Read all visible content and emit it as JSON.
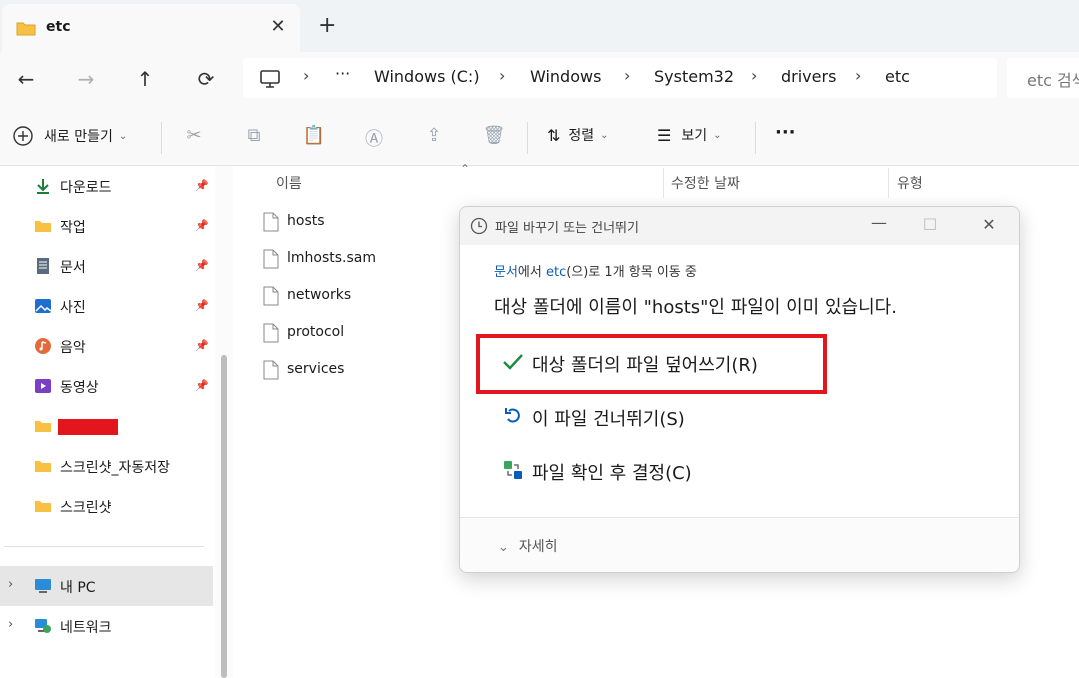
{
  "tab": {
    "title": "etc",
    "close": "✕",
    "new_tab": "+"
  },
  "nav": {
    "back": "←",
    "forward": "→",
    "up": "↑",
    "refresh": "⟳",
    "more": "···",
    "breadcrumbs": [
      "Windows (C:)",
      "Windows",
      "System32",
      "drivers",
      "etc"
    ],
    "search_placeholder": "etc 검색"
  },
  "toolbar": {
    "new_label": "새로 만들기",
    "sort_label": "정렬",
    "view_label": "보기",
    "more": "···"
  },
  "sidebar": {
    "items": [
      {
        "label": "다운로드",
        "icon": "download-icon",
        "pinned": true
      },
      {
        "label": "작업",
        "icon": "folder-icon",
        "pinned": true
      },
      {
        "label": "문서",
        "icon": "document-icon",
        "pinned": true
      },
      {
        "label": "사진",
        "icon": "pictures-icon",
        "pinned": true
      },
      {
        "label": "음악",
        "icon": "music-icon",
        "pinned": true
      },
      {
        "label": "동영상",
        "icon": "video-icon",
        "pinned": true
      },
      {
        "label": "",
        "icon": "folder-icon",
        "redacted": true
      },
      {
        "label": "스크린샷_자동저장",
        "icon": "folder-icon"
      },
      {
        "label": "스크린샷",
        "icon": "folder-icon"
      }
    ],
    "this_pc": "내 PC",
    "network": "네트워크"
  },
  "filelist": {
    "columns": [
      "이름",
      "수정한 날짜",
      "유형"
    ],
    "files": [
      "hosts",
      "lmhosts.sam",
      "networks",
      "protocol",
      "services"
    ]
  },
  "dialog": {
    "title": "파일 바꾸기 또는 건너뛰기",
    "sub_from": "문서",
    "sub_mid1": "에서 ",
    "sub_to": "etc",
    "sub_mid2": "(으)로 1개 항목 이동 중",
    "heading": "대상 폴더에 이름이 \"hosts\"인 파일이 이미 있습니다.",
    "options": [
      {
        "label": "대상 폴더의 파일 덮어쓰기(R)",
        "icon": "checkmark-icon"
      },
      {
        "label": "이 파일 건너뛰기(S)",
        "icon": "undo-icon"
      },
      {
        "label": "파일 확인 후 결정(C)",
        "icon": "compare-icon"
      }
    ],
    "details": "자세히"
  },
  "colors": {
    "accent": "#0a5cb8",
    "highlight": "#e3161e",
    "folder": "#f7c243",
    "redact": "#e3161e"
  }
}
